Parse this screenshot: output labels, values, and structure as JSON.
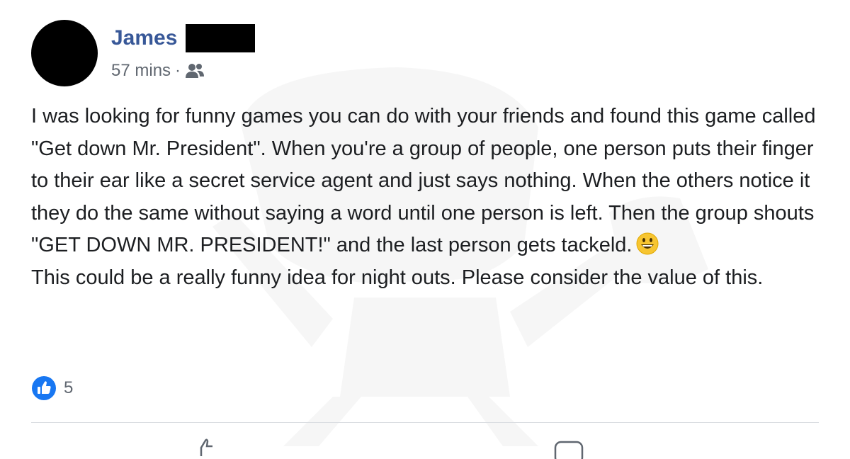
{
  "post": {
    "author_name": "James",
    "timestamp": "57 mins",
    "separator": "·",
    "audience_icon": "friends-icon",
    "paragraphs": [
      "I was looking for funny games you can do with your friends and found this game called \"Get down Mr. President\". When you're a group of people, one person puts their finger to their ear like a secret service agent and just says nothing. When the others notice it they do the same without saying a word until one person is left. Then the group shouts \"GET DOWN MR. PRESIDENT!\" and the last person gets tackeld.",
      "This could be a really funny idea for night outs. Please consider the value of this."
    ],
    "emoji": "grinning-face-emoji",
    "reactions": {
      "icon": "thumbs-up-icon",
      "count": "5"
    }
  },
  "colors": {
    "author_link": "#385898",
    "like_blue": "#1877f2",
    "meta_gray": "#606770",
    "avatar": "#000000",
    "redaction": "#000000"
  }
}
